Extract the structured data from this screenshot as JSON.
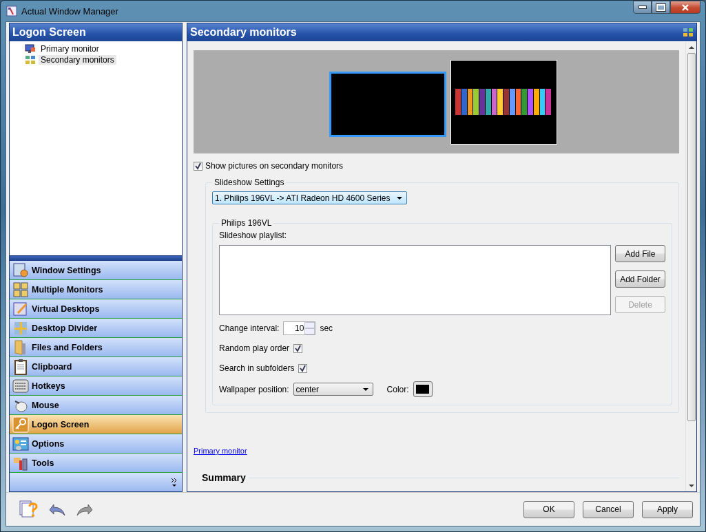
{
  "window": {
    "title": "Actual Window Manager"
  },
  "left_panel": {
    "title": "Logon Screen",
    "tree": [
      {
        "label": "Primary monitor",
        "selected": false
      },
      {
        "label": "Secondary monitors",
        "selected": true
      }
    ],
    "nav": [
      {
        "label": "Window Settings",
        "selected": false
      },
      {
        "label": "Multiple Monitors",
        "selected": false
      },
      {
        "label": "Virtual Desktops",
        "selected": false
      },
      {
        "label": "Desktop Divider",
        "selected": false
      },
      {
        "label": "Files and Folders",
        "selected": false
      },
      {
        "label": "Clipboard",
        "selected": false
      },
      {
        "label": "Hotkeys",
        "selected": false
      },
      {
        "label": "Mouse",
        "selected": false
      },
      {
        "label": "Logon Screen",
        "selected": true
      },
      {
        "label": "Options",
        "selected": false
      },
      {
        "label": "Tools",
        "selected": false
      }
    ]
  },
  "right_panel": {
    "title": "Secondary monitors",
    "monitors": [
      {
        "selected": true,
        "picture": false
      },
      {
        "selected": false,
        "picture": true
      }
    ],
    "show_pictures": {
      "label": "Show pictures on secondary monitors",
      "checked": true
    },
    "slideshow_settings": {
      "title": "Slideshow Settings",
      "monitor_select": "1. Philips 196VL -> ATI Radeon HD 4600 Series",
      "group": {
        "title": "Philips 196VL",
        "playlist_label": "Slideshow playlist:",
        "buttons": [
          {
            "label": "Add File",
            "disabled": false
          },
          {
            "label": "Add Folder",
            "disabled": false
          },
          {
            "label": "Delete",
            "disabled": true
          }
        ],
        "interval": {
          "label": "Change interval:",
          "value": "10",
          "unit": "sec"
        },
        "random": {
          "label": "Random play order",
          "checked": true
        },
        "subfolders": {
          "label": "Search in subfolders",
          "checked": true
        },
        "position": {
          "label": "Wallpaper position:",
          "value": "center"
        },
        "color": {
          "label": "Color:",
          "color": "#000000"
        }
      }
    },
    "link": "Primary monitor",
    "summary": "Summary"
  },
  "buttons": [
    "OK",
    "Cancel",
    "Apply"
  ]
}
